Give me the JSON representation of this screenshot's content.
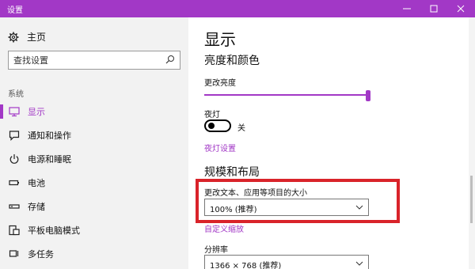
{
  "window": {
    "title": "设置",
    "accent_color": "#a238c6",
    "controls": {
      "minimize": "—",
      "maximize": "□",
      "close": "✕"
    }
  },
  "sidebar": {
    "home_label": "主页",
    "search_placeholder": "查找设置",
    "section_label": "系统",
    "items": [
      {
        "label": "显示",
        "icon": "monitor-icon",
        "active": true
      },
      {
        "label": "通知和操作",
        "icon": "notification-icon",
        "active": false
      },
      {
        "label": "电源和睡眠",
        "icon": "power-icon",
        "active": false
      },
      {
        "label": "电池",
        "icon": "battery-icon",
        "active": false
      },
      {
        "label": "存储",
        "icon": "storage-icon",
        "active": false
      },
      {
        "label": "平板电脑模式",
        "icon": "tablet-mode-icon",
        "active": false
      },
      {
        "label": "多任务",
        "icon": "multitasking-icon",
        "active": false
      }
    ]
  },
  "main": {
    "page_title": "显示",
    "brightness_section": {
      "heading": "亮度和颜色",
      "brightness_label": "更改亮度",
      "brightness_level": 1.0,
      "night_light_label": "夜灯",
      "night_light_state": "关",
      "night_light_settings_link": "夜灯设置"
    },
    "scale_section": {
      "heading": "规模和布局",
      "scale_label": "更改文本、应用等项目的大小",
      "scale_value": "100% (推荐)",
      "custom_scaling_link": "自定义缩放",
      "resolution_label": "分辨率",
      "resolution_value": "1366 × 768 (推荐)"
    },
    "highlight_color": "#d9232a"
  }
}
